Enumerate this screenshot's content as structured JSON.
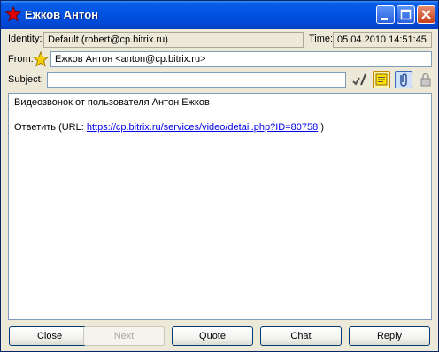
{
  "window": {
    "title": "Ежков Антон"
  },
  "identity": {
    "label": "Identity:",
    "value": "Default (robert@cp.bitrix.ru)"
  },
  "time": {
    "label": "Time:",
    "value": "05.04.2010 14:51:45"
  },
  "from": {
    "label": "From:",
    "value": "Ежков Антон <anton@cp.bitrix.ru>"
  },
  "subject": {
    "label": "Subject:",
    "value": ""
  },
  "message": {
    "line1": "Видеозвонок от пользователя Антон Ежков",
    "reply_prefix": "Ответить (URL: ",
    "link": "https://cp.bitrix.ru/services/video/detail.php?ID=80758",
    "reply_suffix": " )"
  },
  "buttons": {
    "close": "Close",
    "next": "Next",
    "quote": "Quote",
    "chat": "Chat",
    "reply": "Reply"
  },
  "colors": {
    "title_bar": "#0054e3",
    "link": "#0000ee",
    "star": "#f5d000",
    "title_icon": "#e00000"
  },
  "icons": [
    "red-star-icon",
    "minimize-icon",
    "maximize-icon",
    "close-icon",
    "yellow-star-icon",
    "spellcheck-icon",
    "note-icon",
    "attach-icon",
    "lock-icon"
  ]
}
